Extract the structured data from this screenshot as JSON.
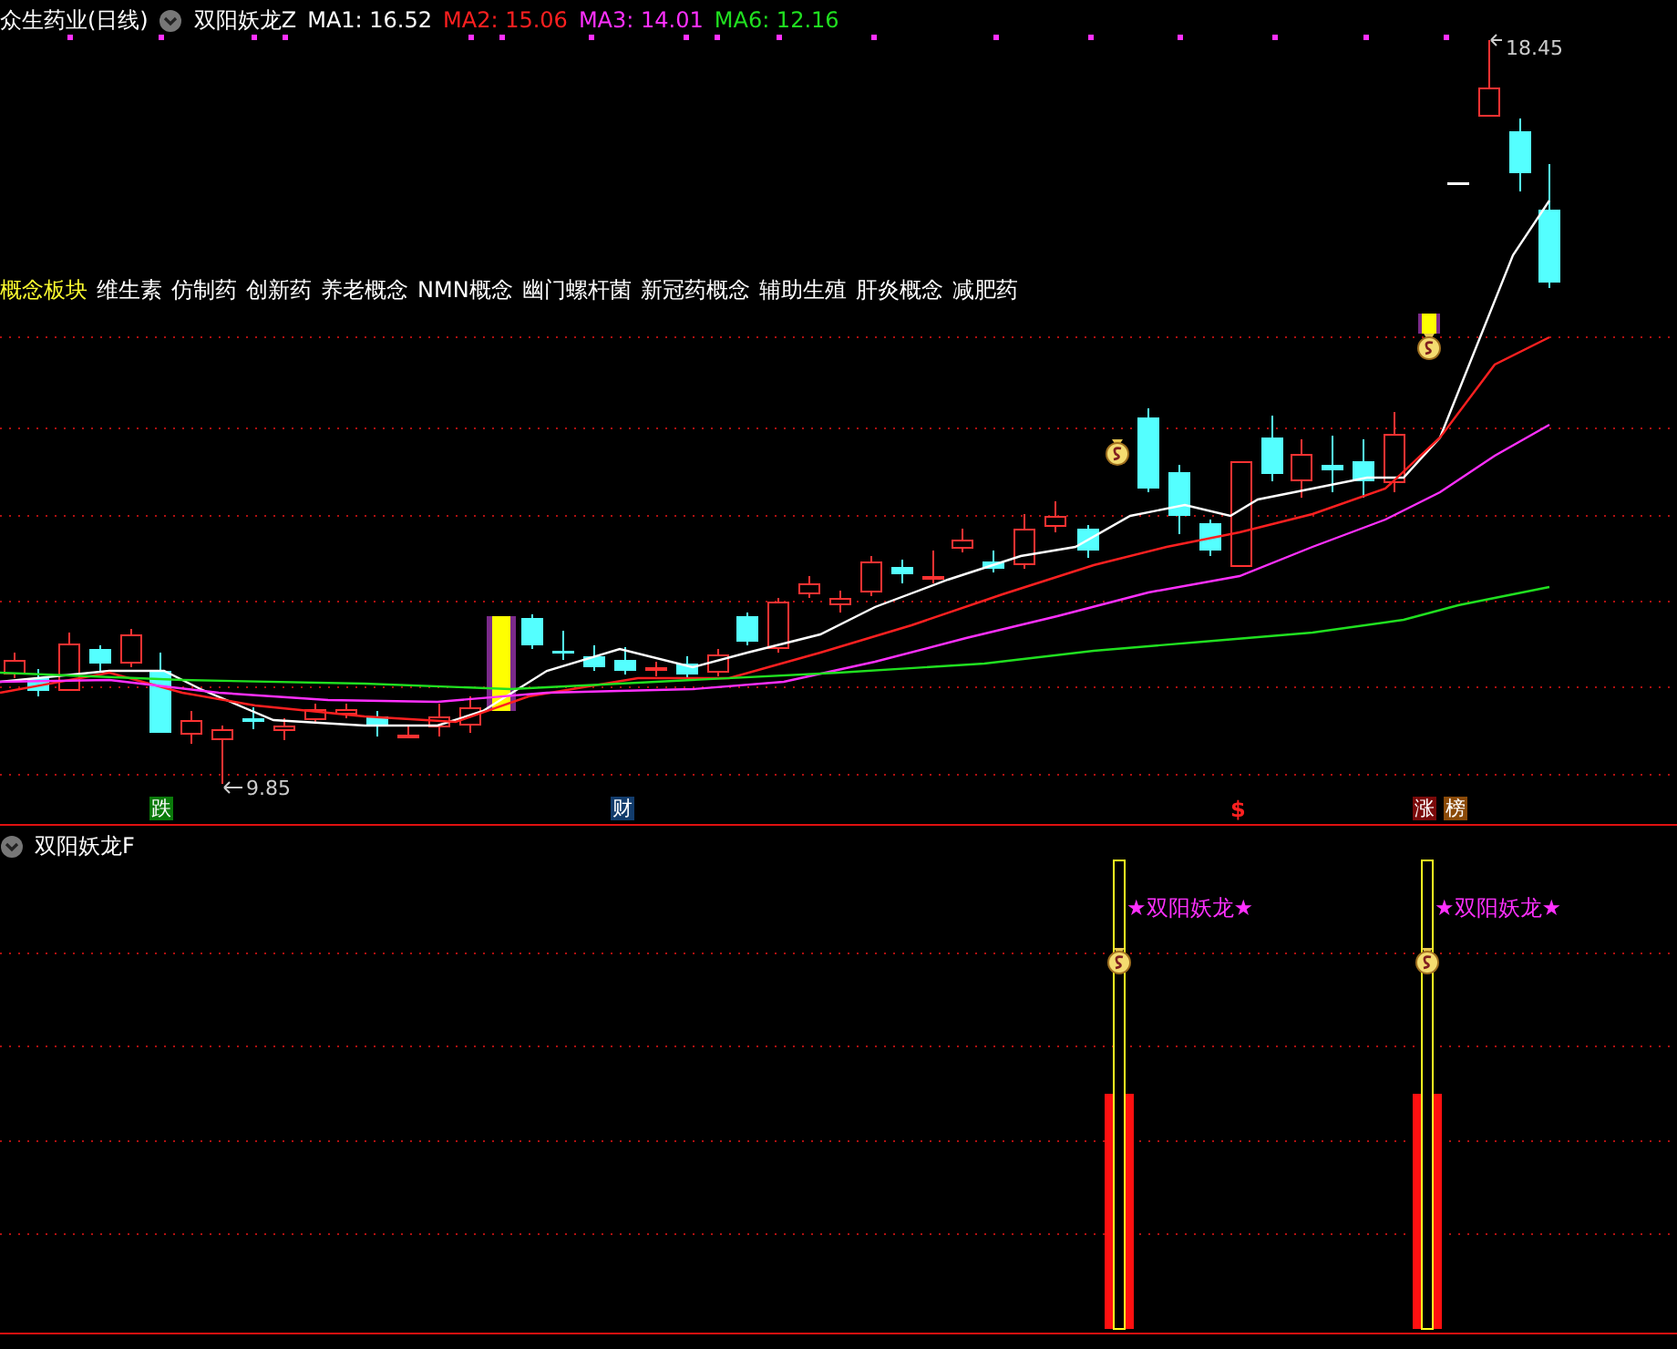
{
  "stock": {
    "name": "众生药业(日线)"
  },
  "main_indicator": {
    "name": "双阳妖龙Z",
    "ma": [
      {
        "label": "MA1:",
        "value": "16.52",
        "color": "#ffffff"
      },
      {
        "label": "MA2:",
        "value": "15.06",
        "color": "#ff2020"
      },
      {
        "label": "MA3:",
        "value": "14.01",
        "color": "#ff30ff"
      },
      {
        "label": "MA6:",
        "value": "12.16",
        "color": "#20e020"
      }
    ]
  },
  "concepts": {
    "label": "概念板块",
    "items": [
      "维生素",
      "仿制药",
      "创新药",
      "养老概念",
      "NMN概念",
      "幽门螺杆菌",
      "新冠药概念",
      "辅助生殖",
      "肝炎概念",
      "减肥药"
    ]
  },
  "price_labels": {
    "high": "18.45",
    "low": "9.85"
  },
  "markers": [
    {
      "text": "跌",
      "kind": "badge",
      "color": "#0a7a0a"
    },
    {
      "text": "财",
      "kind": "badge",
      "color": "#123c6c"
    },
    {
      "text": "$",
      "kind": "glyph",
      "color": "#ff2020"
    },
    {
      "text": "涨",
      "kind": "badge",
      "color": "#7a0a0a"
    },
    {
      "text": "榜",
      "kind": "badge",
      "color": "#8a4a08"
    }
  ],
  "sub_indicator": {
    "name": "双阳妖龙F",
    "signals": [
      {
        "text": "★双阳妖龙★"
      },
      {
        "text": "★双阳妖龙★"
      }
    ]
  }
}
